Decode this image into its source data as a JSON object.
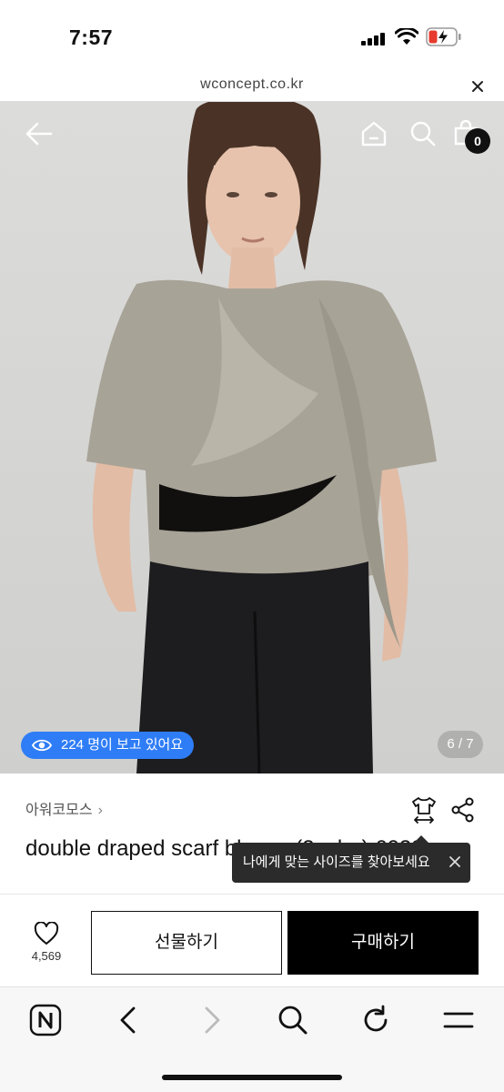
{
  "status_bar": {
    "time": "7:57"
  },
  "url_bar": {
    "domain": "wconcept.co.kr"
  },
  "header": {
    "cart_count": "0"
  },
  "hero": {
    "viewers_label": "224 명이 보고 있어요",
    "pager": "6 / 7"
  },
  "product": {
    "brand": "아워코모스",
    "title": "double draped scarf blouse (2color) 6023",
    "size_tooltip": "나에게 맞는 사이즈를 찾아보세요"
  },
  "actions": {
    "like_count": "4,569",
    "gift_label": "선물하기",
    "buy_label": "구매하기"
  },
  "colors": {
    "accent_blue": "#2f7df6",
    "buy_button": "#000000",
    "tooltip_bg": "#2b2b2b"
  },
  "icons": {
    "hero": [
      "back-arrow-icon",
      "home-icon",
      "search-icon",
      "cart-icon"
    ],
    "product": [
      "size-finder-icon",
      "share-icon",
      "heart-icon"
    ],
    "browser": [
      "naver-n-icon",
      "back-chevron-icon",
      "forward-chevron-icon",
      "search-icon",
      "refresh-icon",
      "menu-icon"
    ]
  }
}
